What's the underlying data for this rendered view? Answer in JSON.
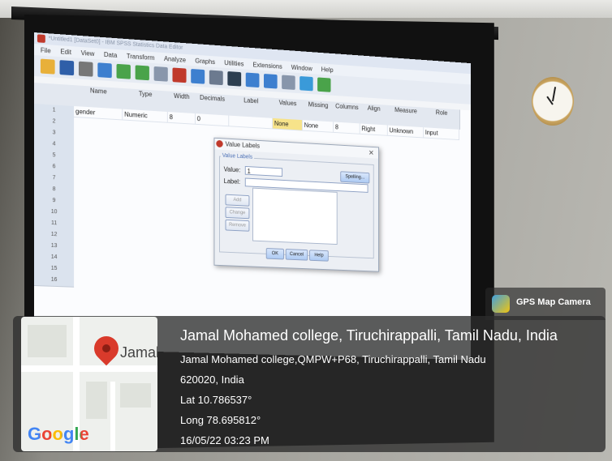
{
  "spss": {
    "window_title": "*Untitled1 [DataSet0] - IBM SPSS Statistics Data Editor",
    "menu": [
      "File",
      "Edit",
      "View",
      "Data",
      "Transform",
      "Analyze",
      "Graphs",
      "Utilities",
      "Extensions",
      "Window",
      "Help"
    ],
    "columns": [
      "Name",
      "Type",
      "Width",
      "Decimals",
      "Label",
      "Values",
      "Missing",
      "Columns",
      "Align",
      "Measure",
      "Role"
    ],
    "row_numbers": [
      "1",
      "2",
      "3",
      "4",
      "5",
      "6",
      "7",
      "8",
      "9",
      "10",
      "11",
      "12",
      "13",
      "14",
      "15",
      "16"
    ],
    "row1": {
      "name": "gender",
      "type": "Numeric",
      "width": "8",
      "decimals": "0",
      "values": "None",
      "missing": "None",
      "columns": "8",
      "align": "Right",
      "measure": "Unknown",
      "role": "Input"
    },
    "dialog": {
      "title": "Value Labels",
      "group": "Value Labels",
      "value_label": "Value:",
      "value": "1",
      "label_label": "Label:",
      "label_value": "",
      "spelling": "Spelling...",
      "add": "Add",
      "change": "Change",
      "remove": "Remove",
      "ok": "OK",
      "cancel": "Cancel",
      "help": "Help"
    }
  },
  "overlay": {
    "app_name": "GPS Map Camera",
    "map_place": "Jamal",
    "map_brand": "Google",
    "place_title": "Jamal Mohamed college, Tiruchirappalli, Tamil Nadu, India",
    "address_line1": "Jamal Mohamed college,QMPW+P68, Tiruchirappalli, Tamil Nadu",
    "address_line2": "620020, India",
    "lat": "Lat 10.786537°",
    "long": "Long 78.695812°",
    "datetime": "16/05/22 03:23 PM"
  }
}
